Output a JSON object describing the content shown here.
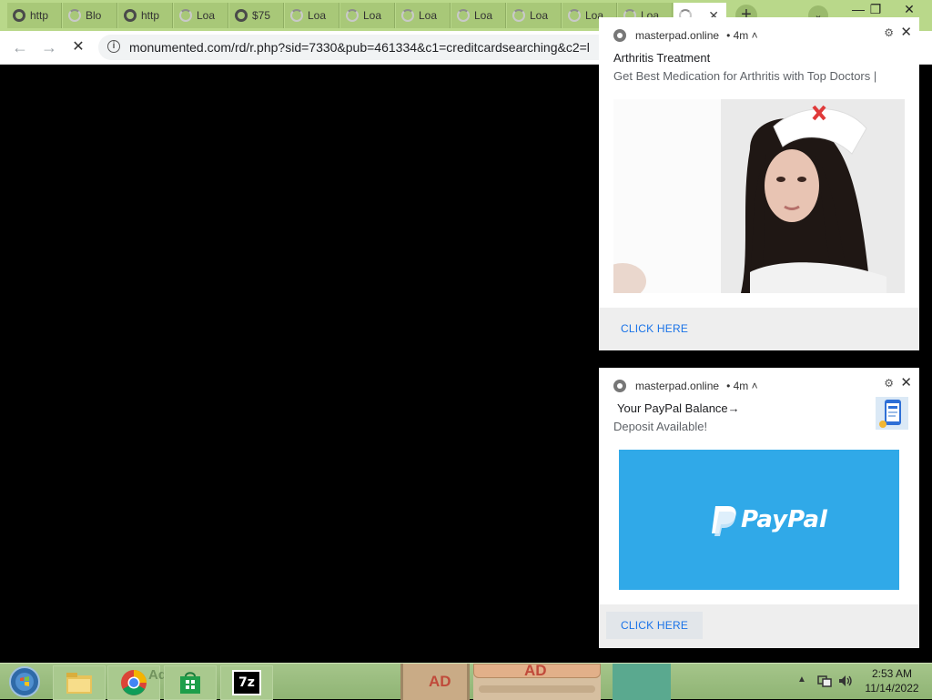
{
  "browser": {
    "tabs": [
      {
        "title": "http",
        "icon": "globe-icon"
      },
      {
        "title": "Blo",
        "icon": "loading-spinner-icon"
      },
      {
        "title": "http",
        "icon": "globe-icon"
      },
      {
        "title": "Loa",
        "icon": "loading-spinner-icon"
      },
      {
        "title": "$75",
        "icon": "globe-icon"
      },
      {
        "title": "Loa",
        "icon": "loading-spinner-icon"
      },
      {
        "title": "Loa",
        "icon": "loading-spinner-icon"
      },
      {
        "title": "Loa",
        "icon": "loading-spinner-icon"
      },
      {
        "title": "Loa",
        "icon": "loading-spinner-icon"
      },
      {
        "title": "Loa",
        "icon": "loading-spinner-icon"
      },
      {
        "title": "Loa",
        "icon": "loading-spinner-icon"
      },
      {
        "title": "Loa",
        "icon": "loading-spinner-icon"
      }
    ],
    "active_tab_close": "✕",
    "new_tab_symbol": "+",
    "tab_search_symbol": "⌄",
    "window_controls": {
      "minimize": "—",
      "restore": "❐",
      "close": "✕"
    },
    "nav": {
      "back": "←",
      "forward": "→",
      "stop": "✕"
    },
    "url": "monumented.com/rd/r.php?sid=7330&pub=461334&c1=creditcardsearching&c2=l",
    "info_symbol": "i"
  },
  "notifications": [
    {
      "source": "masterpad.online",
      "age": "• 4m ˄",
      "title": "Arthritis Treatment",
      "body": "Get Best Medication for Arthritis with Top Doctors |",
      "action": "CLICK HERE"
    },
    {
      "source": "masterpad.online",
      "age": "• 4m ˄",
      "title": "Your PayPal Balance→",
      "body": "Deposit Available!",
      "brand_text": "PayPal",
      "action": "CLICK HERE"
    }
  ],
  "taskbar": {
    "clock_time": "2:53 AM",
    "clock_date": "11/14/2022",
    "adchoice_label": "AdChoice",
    "ad_labels": [
      "AD",
      "AD"
    ],
    "sevenzip_label": "7z"
  },
  "colors": {
    "tabstrip": "#b9d88a",
    "paypal_blue": "#30a9e8",
    "link_blue": "#1a73e8"
  }
}
